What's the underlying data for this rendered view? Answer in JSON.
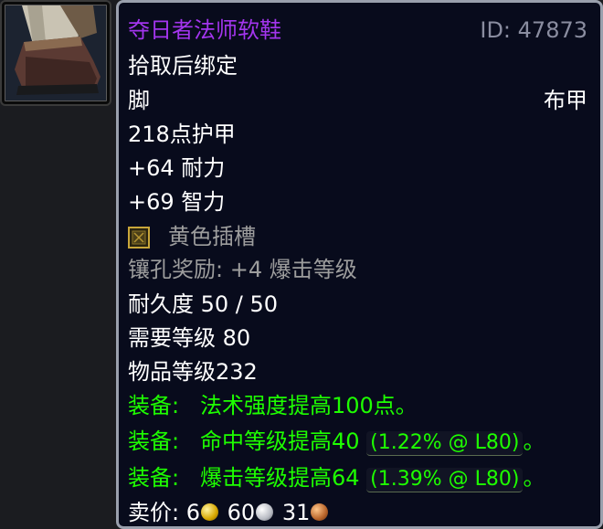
{
  "item": {
    "name": "夺日者法师软鞋",
    "id_text": "ID: 47873",
    "bind": "拾取后绑定",
    "slot": "脚",
    "armor_type": "布甲",
    "armor": "218点护甲",
    "stats": [
      "+64 耐力",
      "+69 智力"
    ],
    "socket_label": "黄色插槽",
    "socket_bonus": "镶孔奖励: +4 爆击等级",
    "durability": "耐久度 50 / 50",
    "required_level": "需要等级 80",
    "item_level": "物品等级232",
    "equip": [
      {
        "prefix": "装备:",
        "text": "法术强度提高100点。",
        "extra": ""
      },
      {
        "prefix": "装备:",
        "text": "命中等级提高40",
        "extra": "(1.22% @ L80)",
        "suffix": "。"
      },
      {
        "prefix": "装备:",
        "text": "爆击等级提高64",
        "extra": "(1.39% @ L80)",
        "suffix": "。"
      }
    ],
    "sell": {
      "label": "卖价:",
      "gold": "6",
      "silver": "60",
      "copper": "31"
    }
  },
  "colors": {
    "epic": "#a335ee",
    "equip": "#1eff00",
    "socket_bonus": "#9d9d9d"
  },
  "icons": {
    "item": "cloth-boots-icon",
    "socket": "yellow-socket-icon"
  }
}
